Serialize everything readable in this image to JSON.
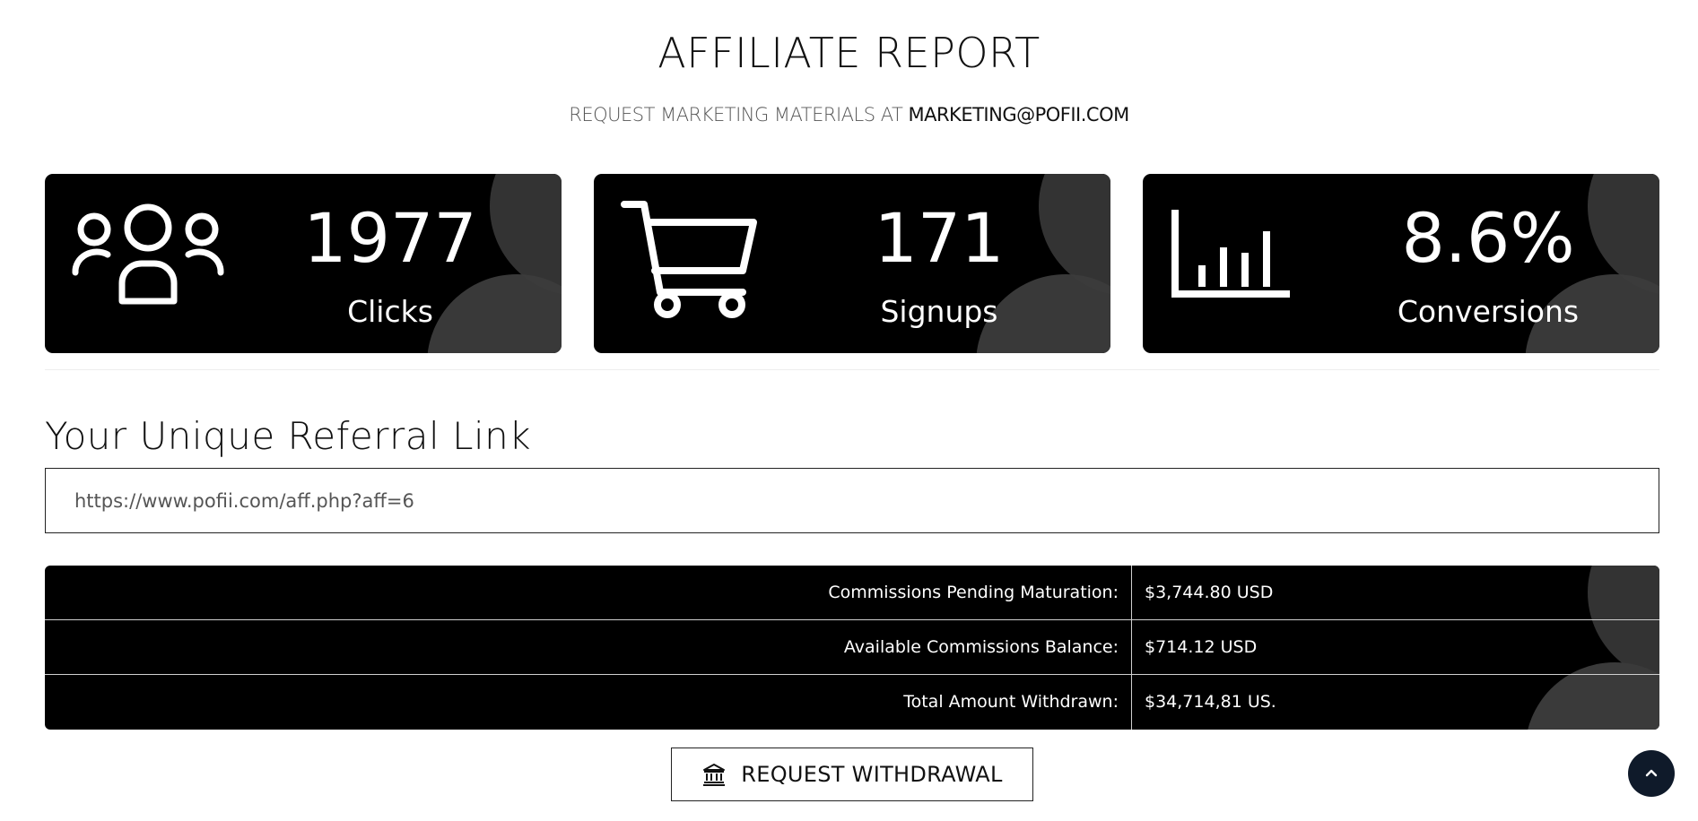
{
  "header": {
    "title": "AFFILIATE REPORT",
    "subtitle_lead": "REQUEST MARKETING MATERIALS AT ",
    "subtitle_email": "MARKETING@POFII.COM"
  },
  "stats": [
    {
      "icon": "users-icon",
      "value": "1977",
      "label": "Clicks"
    },
    {
      "icon": "cart-icon",
      "value": "171",
      "label": "Signups"
    },
    {
      "icon": "bar-chart-icon",
      "value": "8.6%",
      "label": "Conversions"
    }
  ],
  "referral": {
    "heading": "Your Unique Referral Link",
    "link": "https://www.pofii.com/aff.php?aff=6"
  },
  "commissions": [
    {
      "label": "Commissions Pending Maturation:",
      "amount": "$3,744.80 USD"
    },
    {
      "label": "Available Commissions Balance:",
      "amount": "$714.12 USD"
    },
    {
      "label": "Total Amount Withdrawn:",
      "amount": "$34,714,81 US."
    }
  ],
  "actions": {
    "withdraw_label": "REQUEST WITHDRAWAL",
    "withdraw_icon": "bank-icon",
    "scroll_top_icon": "chevron-up-icon"
  },
  "colors": {
    "card_bg": "#000000",
    "card_circle": "#333333",
    "scroll_button": "#0f1a2a"
  }
}
